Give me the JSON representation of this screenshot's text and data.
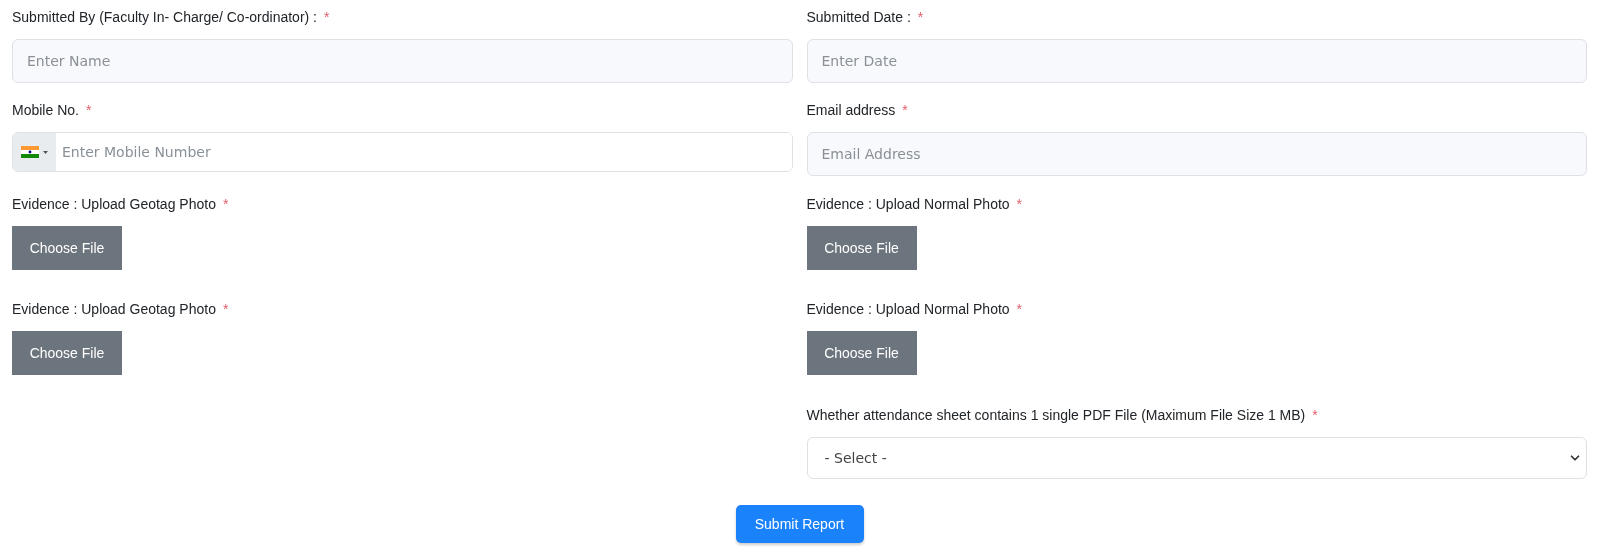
{
  "rows": [
    {
      "left": {
        "kind": "text",
        "label": "Submitted By (Faculty In- Charge/ Co-ordinator) :",
        "mark": "*",
        "placeholder": "Enter Name"
      },
      "right": {
        "kind": "text",
        "label": "Submitted Date :",
        "mark": "*",
        "placeholder": "Enter Date"
      }
    },
    {
      "left": {
        "kind": "phone",
        "label": "Mobile No.",
        "mark": "*",
        "placeholder": "Enter Mobile Number"
      },
      "right": {
        "kind": "text",
        "label": "Email address",
        "mark": "*",
        "placeholder": "Email Address"
      }
    },
    {
      "left": {
        "kind": "file",
        "label": "Evidence : Upload Geotag Photo",
        "mark": "*",
        "button": "Choose File"
      },
      "right": {
        "kind": "file",
        "label": "Evidence : Upload Normal Photo",
        "mark": "*",
        "button": "Choose File"
      }
    },
    {
      "left": {
        "kind": "file",
        "label": "Evidence : Upload Geotag Photo",
        "mark": "*",
        "button": "Choose File"
      },
      "right": {
        "kind": "file",
        "label": "Evidence : Upload Normal Photo",
        "mark": "*",
        "button": "Choose File"
      }
    },
    {
      "right": {
        "kind": "select",
        "label": "Whether attendance sheet contains 1 single PDF File (Maximum File Size 1 MB)",
        "mark": "*",
        "value": "- Select -"
      }
    }
  ],
  "submit": "Submit Report"
}
